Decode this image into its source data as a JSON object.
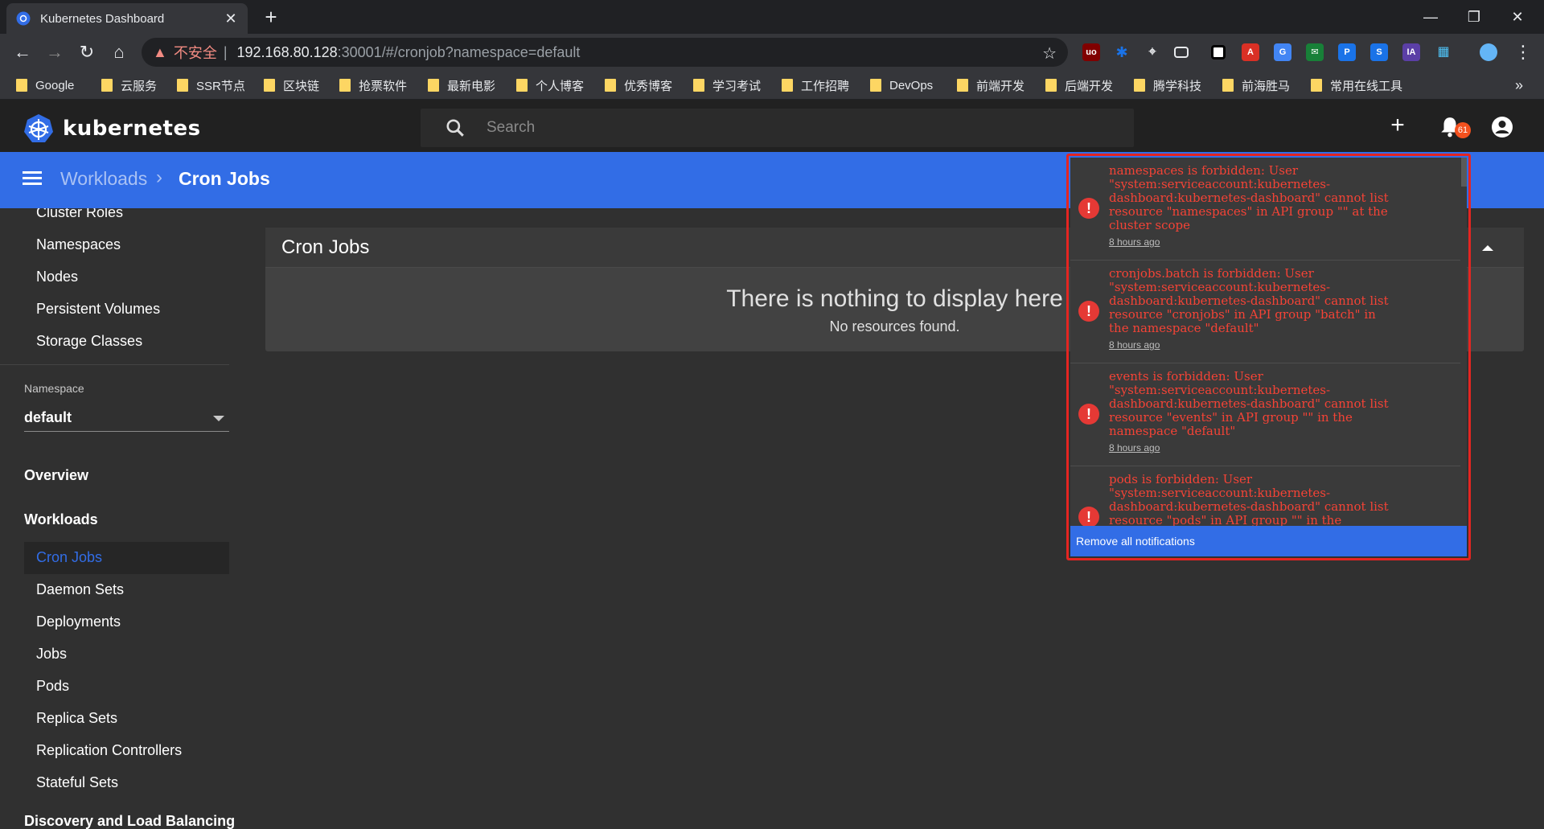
{
  "browser": {
    "tab_title": "Kubernetes Dashboard",
    "url_warning": "不安全",
    "url_separator": "|",
    "url_host": "192.168.80.128",
    "url_path": ":30001/#/cronjob?namespace=default",
    "bookmarks": [
      "Google",
      "云服务",
      "SSR节点",
      "区块链",
      "抢票软件",
      "最新电影",
      "个人博客",
      "优秀博客",
      "学习考试",
      "工作招聘",
      "DevOps",
      "前端开发",
      "后端开发",
      "腾学科技",
      "前海胜马",
      "常用在线工具"
    ],
    "overflow": "»"
  },
  "header": {
    "brand": "kubernetes",
    "search_placeholder": "Search",
    "notification_count": "61"
  },
  "toolbar": {
    "crumb_parent": "Workloads",
    "crumb_current": "Cron Jobs"
  },
  "sidebar": {
    "cluster_items": [
      "Cluster Roles",
      "Namespaces",
      "Nodes",
      "Persistent Volumes",
      "Storage Classes"
    ],
    "namespace_label": "Namespace",
    "namespace_value": "default",
    "overview": "Overview",
    "workloads": "Workloads",
    "workload_items": [
      "Cron Jobs",
      "Daemon Sets",
      "Deployments",
      "Jobs",
      "Pods",
      "Replica Sets",
      "Replication Controllers",
      "Stateful Sets"
    ],
    "discovery": "Discovery and Load Balancing"
  },
  "main": {
    "card_title": "Cron Jobs",
    "empty_title": "There is nothing to display here",
    "empty_subtitle": "No resources found."
  },
  "notifications": {
    "items": [
      {
        "message": "namespaces is forbidden: User\n\"system:serviceaccount:kubernetes-\ndashboard:kubernetes-dashboard\" cannot list\nresource \"namespaces\" in API group \"\" at the\ncluster scope",
        "time": "8 hours ago"
      },
      {
        "message": "cronjobs.batch is forbidden: User\n\"system:serviceaccount:kubernetes-\ndashboard:kubernetes-dashboard\" cannot list\nresource \"cronjobs\" in API group \"batch\" in\nthe namespace \"default\"",
        "time": "8 hours ago"
      },
      {
        "message": "events is forbidden: User\n\"system:serviceaccount:kubernetes-\ndashboard:kubernetes-dashboard\" cannot list\nresource \"events\" in API group \"\" in the\nnamespace \"default\"",
        "time": "8 hours ago"
      },
      {
        "message": "pods is forbidden: User\n\"system:serviceaccount:kubernetes-\ndashboard:kubernetes-dashboard\" cannot list\nresource \"pods\" in API group \"\" in the",
        "time": ""
      }
    ],
    "remove_all": "Remove all notifications"
  },
  "colors": {
    "accent": "#326de6",
    "error": "#f44336",
    "highlight_outline": "#e52521"
  }
}
